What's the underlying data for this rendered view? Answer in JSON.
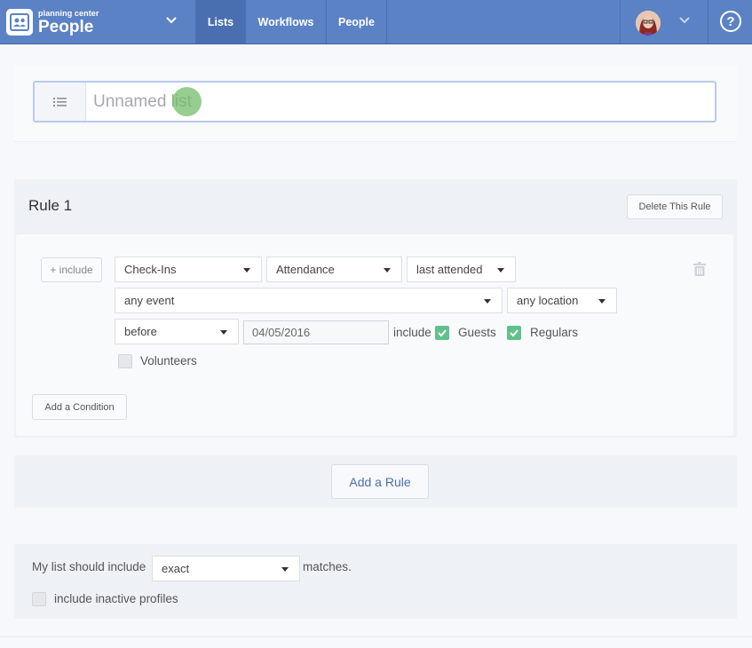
{
  "nav": {
    "brand_small": "planning center",
    "brand_big": "People",
    "tabs": [
      {
        "label": "Lists",
        "active": true
      },
      {
        "label": "Workflows",
        "active": false
      },
      {
        "label": "People",
        "active": false
      }
    ],
    "help_glyph": "?"
  },
  "list_name": {
    "placeholder": "Unnamed list",
    "value": ""
  },
  "rule": {
    "title": "Rule 1",
    "delete_label": "Delete This Rule",
    "include_label": "+ include",
    "condition": {
      "category": "Check-Ins",
      "type": "Attendance",
      "metric": "last attended",
      "event": "any event",
      "location": "any location",
      "comparison": "before",
      "date": "04/05/2016",
      "include_label": "include",
      "guests_label": "Guests",
      "guests_checked": true,
      "regulars_label": "Regulars",
      "regulars_checked": true,
      "volunteers_label": "Volunteers",
      "volunteers_checked": false
    },
    "add_condition_label": "Add a Condition"
  },
  "add_rule_label": "Add a Rule",
  "options": {
    "prefix": "My list should include",
    "match_value": "exact",
    "suffix": "matches.",
    "inactive_label": "include inactive profiles",
    "inactive_checked": false
  },
  "colors": {
    "nav_bg": "#5b82c4",
    "nav_active": "#4a6fb0",
    "check_green": "#62c08a",
    "accent_blue": "#4b6fae"
  }
}
